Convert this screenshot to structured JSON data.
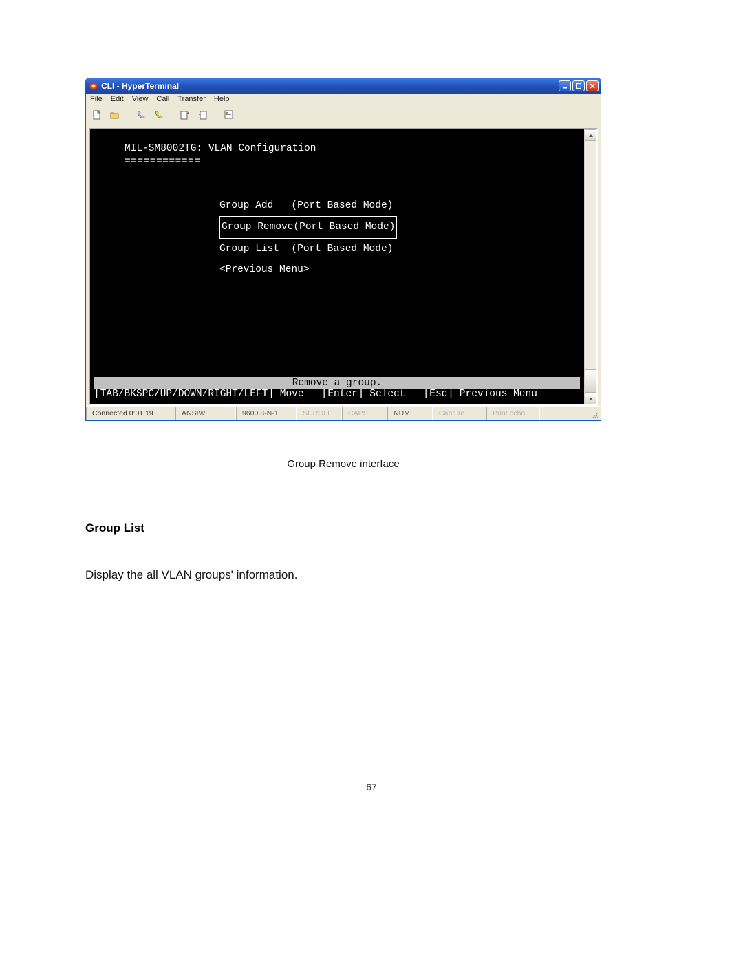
{
  "window": {
    "title": "CLI - HyperTerminal",
    "menubar": [
      "File",
      "Edit",
      "View",
      "Call",
      "Transfer",
      "Help"
    ]
  },
  "terminal": {
    "header": "MIL-SM8002TG: VLAN Configuration",
    "underline": "============",
    "menu": [
      {
        "label": "Group Add   (Port Based Mode)",
        "selected": false
      },
      {
        "label": "Group Remove(Port Based Mode)",
        "selected": true
      },
      {
        "label": "Group List  (Port Based Mode)",
        "selected": false
      },
      {
        "label": "<Previous Menu>",
        "selected": false
      }
    ],
    "hint": "Remove a group.",
    "help": "[TAB/BKSPC/UP/DOWN/RIGHT/LEFT] Move   [Enter] Select   [Esc] Previous Menu"
  },
  "status": {
    "connection": "Connected 0:01:19",
    "emulation": "ANSIW",
    "params": "9600 8-N-1",
    "scroll": "SCROLL",
    "caps": "CAPS",
    "num": "NUM",
    "capture": "Capture",
    "printecho": "Print echo"
  },
  "document": {
    "caption": "Group Remove interface",
    "section_title": "Group List",
    "body": "Display the all VLAN groups' information.",
    "page_number": "67"
  }
}
